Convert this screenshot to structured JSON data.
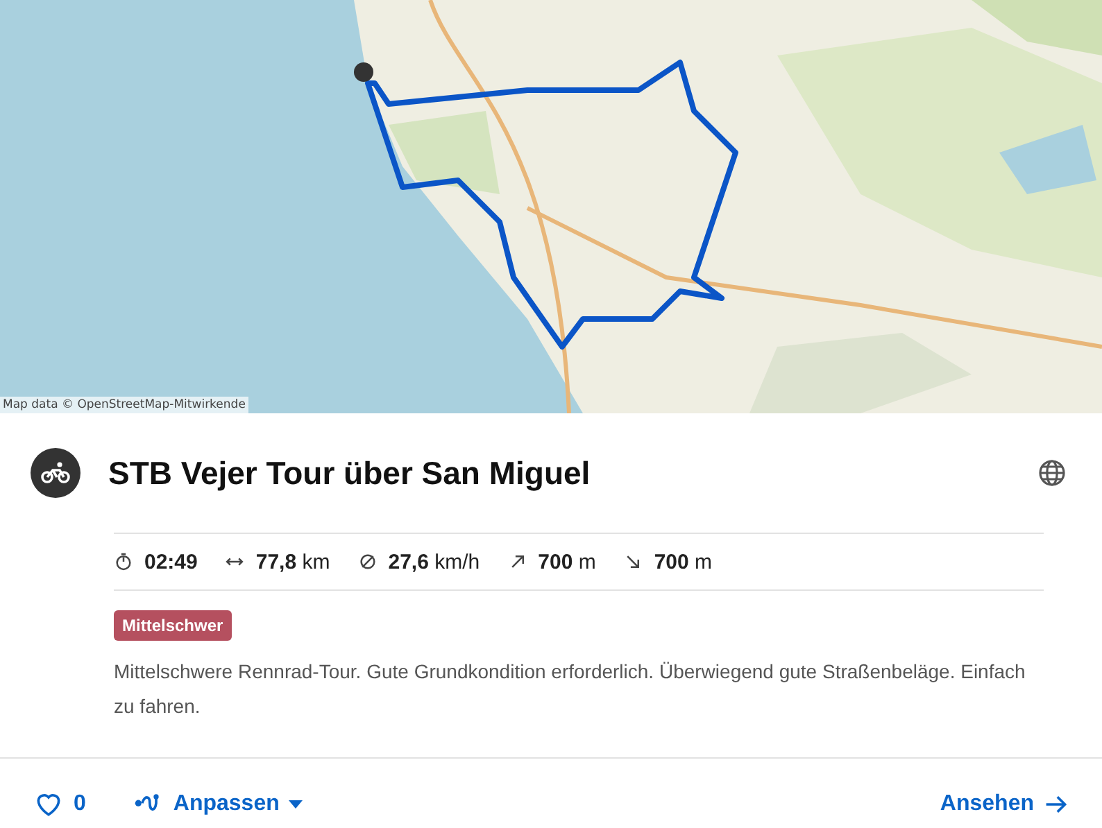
{
  "map": {
    "kind": "picture",
    "attribution": "Map data © OpenStreetMap-Mitwirkende"
  },
  "tour": {
    "kind": "bike",
    "title": "STB Vejer Tour über San Miguel",
    "public": true
  },
  "stats": [
    {
      "kind": "duration",
      "value": "02:49"
    },
    {
      "kind": "distance",
      "value": "77,8",
      "unit": "km"
    },
    {
      "kind": "speed",
      "value": "27,6",
      "unit": "km/h"
    },
    {
      "kind": "uphill",
      "value": "700",
      "unit": "m"
    },
    {
      "kind": "downhill",
      "value": "700",
      "unit": "m"
    }
  ],
  "difficulty": {
    "label": "Mittelschwer",
    "color": "#b5505f"
  },
  "description": "Mittelschwere Rennrad-Tour. Gute Grundkondition erforderlich. Überwiegend gute Straßenbeläge. Einfach zu fahren.",
  "actions": {
    "likes": "0",
    "customize": "Anpassen",
    "view": "Ansehen"
  }
}
